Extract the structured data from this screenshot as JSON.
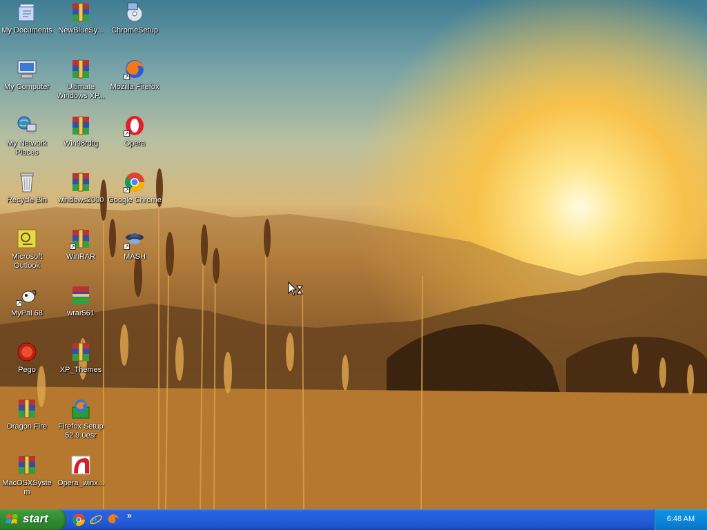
{
  "desktop": {
    "icons": [
      {
        "label": "My Documents",
        "icon": "my-documents-icon"
      },
      {
        "label": "NewBlueSy...",
        "icon": "winrar-archive-icon"
      },
      {
        "label": "ChromeSetup",
        "icon": "setup-installer-icon"
      },
      {
        "label": "My Computer",
        "icon": "my-computer-icon"
      },
      {
        "label": "Ultimate Windows XP...",
        "icon": "winrar-archive-icon"
      },
      {
        "label": "Mozilla Firefox",
        "icon": "firefox-icon"
      },
      {
        "label": "My Network Places",
        "icon": "network-places-icon"
      },
      {
        "label": "Win98rdtg",
        "icon": "winrar-archive-icon"
      },
      {
        "label": "Opera",
        "icon": "opera-icon"
      },
      {
        "label": "Recycle Bin",
        "icon": "recycle-bin-icon"
      },
      {
        "label": "windows2000",
        "icon": "winrar-archive-icon"
      },
      {
        "label": "Google Chrome",
        "icon": "chrome-icon"
      },
      {
        "label": "Microsoft Outlook",
        "icon": "outlook-icon"
      },
      {
        "label": "WinRAR",
        "icon": "winrar-icon"
      },
      {
        "label": "MASH",
        "icon": "mash-icon"
      },
      {
        "label": "MyPal 68",
        "icon": "mypal-icon"
      },
      {
        "label": "wrar561",
        "icon": "winrar-installer-icon"
      },
      {
        "label": "Pego",
        "icon": "pego-icon"
      },
      {
        "label": "XP_Themes",
        "icon": "winrar-archive-icon"
      },
      {
        "label": "Dragon Fire",
        "icon": "winrar-archive-icon"
      },
      {
        "label": "Firefox Setup 52.9.0esr",
        "icon": "firefox-setup-icon"
      },
      {
        "label": "MacOSXSystem",
        "icon": "winrar-archive-icon"
      },
      {
        "label": "Opera_winx...",
        "icon": "opera-installer-icon"
      }
    ]
  },
  "taskbar": {
    "start_label": "start",
    "quick_launch": [
      "chrome-icon",
      "internet-explorer-icon",
      "firefox-icon"
    ],
    "overflow_chevron": "»",
    "clock": "6:48 AM"
  },
  "colors": {
    "taskbar_blue": "#245edb",
    "start_green": "#3c9a3c",
    "tray_blue": "#0c84d8"
  }
}
